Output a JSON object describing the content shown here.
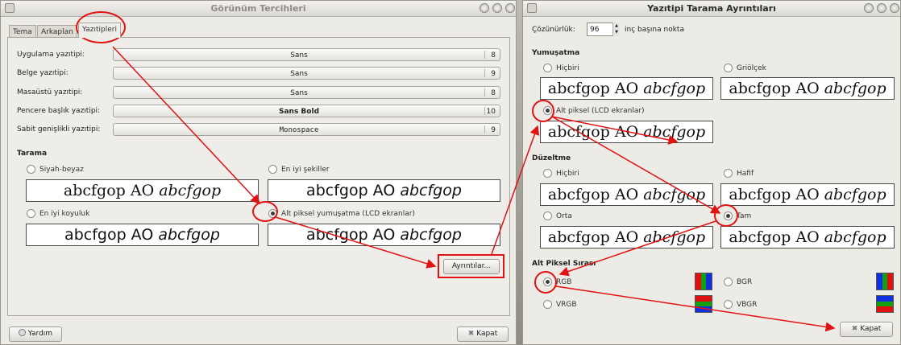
{
  "left": {
    "title": "Görünüm Tercihleri",
    "tabs": [
      "Tema",
      "Arkaplan",
      "Yazıtipleri"
    ],
    "fonts": [
      {
        "label": "Uygulama yazıtipi:",
        "font": "Sans",
        "size": "8"
      },
      {
        "label": "Belge yazıtipi:",
        "font": "Sans",
        "size": "9"
      },
      {
        "label": "Masaüstü yazıtipi:",
        "font": "Sans",
        "size": "8"
      },
      {
        "label": "Pencere başlık yazıtipi:",
        "font": "Sans Bold",
        "size": "10"
      },
      {
        "label": "Sabit genişlikli yazıtipi:",
        "font": "Monospace",
        "size": "9"
      }
    ],
    "rendering_title": "Tarama",
    "rendering": [
      {
        "label": "Siyah-beyaz",
        "sample_a": "abcfgop AO",
        "sample_b": "abcfgop"
      },
      {
        "label": "En iyi şekiller",
        "sample_a": "abcfgop AO",
        "sample_b": "abcfgop"
      },
      {
        "label": "En iyi koyuluk",
        "sample_a": "abcfgop AO",
        "sample_b": "abcfgop"
      },
      {
        "label": "Alt piksel yumuşatma (LCD ekranlar)",
        "sample_a": "abcfgop AO",
        "sample_b": "abcfgop"
      }
    ],
    "details_button": "Ayrıntılar...",
    "help_button": "Yardım",
    "close_button": "Kapat"
  },
  "right": {
    "title": "Yazıtipi Tarama Ayrıntıları",
    "resolution_label": "Çözünürlük:",
    "resolution_value": "96",
    "resolution_unit": "inç başına nokta",
    "smoothing_title": "Yumuşatma",
    "smoothing": [
      {
        "label": "Hiçbiri",
        "sample_a": "abcfgop AO",
        "sample_b": "abcfgop"
      },
      {
        "label": "Griölçek",
        "sample_a": "abcfgop AO",
        "sample_b": "abcfgop"
      },
      {
        "label": "Alt piksel (LCD ekranlar)",
        "sample_a": "abcfgop AO",
        "sample_b": "abcfgop"
      }
    ],
    "hinting_title": "Düzeltme",
    "hinting": [
      {
        "label": "Hiçbiri",
        "sample_a": "abcfgop AO",
        "sample_b": "abcfgop"
      },
      {
        "label": "Hafif",
        "sample_a": "abcfgop AO",
        "sample_b": "abcfgop"
      },
      {
        "label": "Orta",
        "sample_a": "abcfgop AO",
        "sample_b": "abcfgop"
      },
      {
        "label": "Tam",
        "sample_a": "abcfgop AO",
        "sample_b": "abcfgop"
      }
    ],
    "order_title": "Alt Piksel Sırası",
    "order": [
      {
        "label": "RGB",
        "colors": [
          "#e01010",
          "#10a010",
          "#1030e0"
        ]
      },
      {
        "label": "BGR",
        "colors": [
          "#1030e0",
          "#10a010",
          "#e01010"
        ]
      },
      {
        "label": "VRGB",
        "colors": [
          "#e01010",
          "#10a010",
          "#1030e0"
        ]
      },
      {
        "label": "VBGR",
        "colors": [
          "#1030e0",
          "#10a010",
          "#e01010"
        ]
      }
    ],
    "close_button": "Kapat"
  },
  "annotation_color": "#e01212"
}
